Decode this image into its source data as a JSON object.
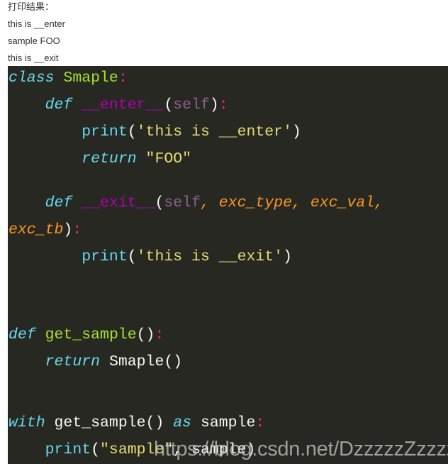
{
  "output": {
    "heading": "打印结果：",
    "lines": [
      "this is __enter",
      "sample FOO",
      "this is __exit"
    ]
  },
  "code": {
    "language": "python",
    "theme_colors": {
      "background": "#272822",
      "keyword": "#66d9ef",
      "class_function_name": "#a6e22e",
      "magic_method": "#ae00ae",
      "self": "#8e5e8e",
      "parameter": "#fd971f",
      "colon": "#f92672",
      "string": "#e6db74",
      "default": "#f8f8f2"
    },
    "lines": [
      {
        "tokens": [
          {
            "t": "class",
            "c": "kw"
          },
          {
            "t": " ",
            "c": "plain"
          },
          {
            "t": "Smaple",
            "c": "cls"
          },
          {
            "t": ":",
            "c": "pink"
          }
        ]
      },
      {
        "tokens": [
          {
            "t": "    ",
            "c": "plain"
          },
          {
            "t": "def",
            "c": "kw"
          },
          {
            "t": " ",
            "c": "plain"
          },
          {
            "t": "__enter__",
            "c": "magic"
          },
          {
            "t": "(",
            "c": "plain"
          },
          {
            "t": "self",
            "c": "self"
          },
          {
            "t": ")",
            "c": "plain"
          },
          {
            "t": ":",
            "c": "pink"
          }
        ]
      },
      {
        "tokens": [
          {
            "t": "        ",
            "c": "plain"
          },
          {
            "t": "print",
            "c": "builtin"
          },
          {
            "t": "(",
            "c": "plain"
          },
          {
            "t": "'this is __enter'",
            "c": "str"
          },
          {
            "t": ")",
            "c": "plain"
          }
        ]
      },
      {
        "tokens": [
          {
            "t": "        ",
            "c": "plain"
          },
          {
            "t": "return",
            "c": "kw"
          },
          {
            "t": " ",
            "c": "plain"
          },
          {
            "t": "\"FOO\"",
            "c": "str"
          }
        ]
      },
      {
        "tokens": [
          {
            "t": "    ",
            "c": "plain"
          },
          {
            "t": "def",
            "c": "kw"
          },
          {
            "t": " ",
            "c": "plain"
          },
          {
            "t": "__exit__",
            "c": "magic"
          },
          {
            "t": "(",
            "c": "plain"
          },
          {
            "t": "self",
            "c": "self"
          },
          {
            "t": ", ",
            "c": "param"
          },
          {
            "t": "exc_type",
            "c": "param"
          },
          {
            "t": ", ",
            "c": "param"
          },
          {
            "t": "exc_val",
            "c": "param"
          },
          {
            "t": ",",
            "c": "param"
          }
        ]
      },
      {
        "tokens": [
          {
            "t": "exc_tb",
            "c": "param"
          },
          {
            "t": ")",
            "c": "plain"
          },
          {
            "t": ":",
            "c": "pink"
          }
        ]
      },
      {
        "tokens": [
          {
            "t": "        ",
            "c": "plain"
          },
          {
            "t": "print",
            "c": "builtin"
          },
          {
            "t": "(",
            "c": "plain"
          },
          {
            "t": "'this is __exit'",
            "c": "str"
          },
          {
            "t": ")",
            "c": "plain"
          }
        ]
      },
      {
        "tokens": [
          {
            "t": "def",
            "c": "kw"
          },
          {
            "t": " ",
            "c": "plain"
          },
          {
            "t": "get_sample",
            "c": "fn"
          },
          {
            "t": "()",
            "c": "plain"
          },
          {
            "t": ":",
            "c": "pink"
          }
        ]
      },
      {
        "tokens": [
          {
            "t": "    ",
            "c": "plain"
          },
          {
            "t": "return",
            "c": "kw"
          },
          {
            "t": " ",
            "c": "plain"
          },
          {
            "t": "Smaple()",
            "c": "plain"
          }
        ]
      },
      {
        "tokens": [
          {
            "t": "with",
            "c": "kw"
          },
          {
            "t": " ",
            "c": "plain"
          },
          {
            "t": "get_sample()",
            "c": "plain"
          },
          {
            "t": " ",
            "c": "plain"
          },
          {
            "t": "as",
            "c": "kw"
          },
          {
            "t": " ",
            "c": "plain"
          },
          {
            "t": "sample",
            "c": "plain"
          },
          {
            "t": ":",
            "c": "pink"
          }
        ]
      },
      {
        "tokens": [
          {
            "t": "    ",
            "c": "plain"
          },
          {
            "t": "print",
            "c": "builtin"
          },
          {
            "t": "(",
            "c": "plain"
          },
          {
            "t": "\"sample\"",
            "c": "str"
          },
          {
            "t": ", ",
            "c": "plain"
          },
          {
            "t": "sample",
            "c": "plain"
          },
          {
            "t": ")",
            "c": "plain"
          }
        ]
      }
    ]
  },
  "watermark": "https://blog.csdn.net/DzzzzzZzzzz"
}
